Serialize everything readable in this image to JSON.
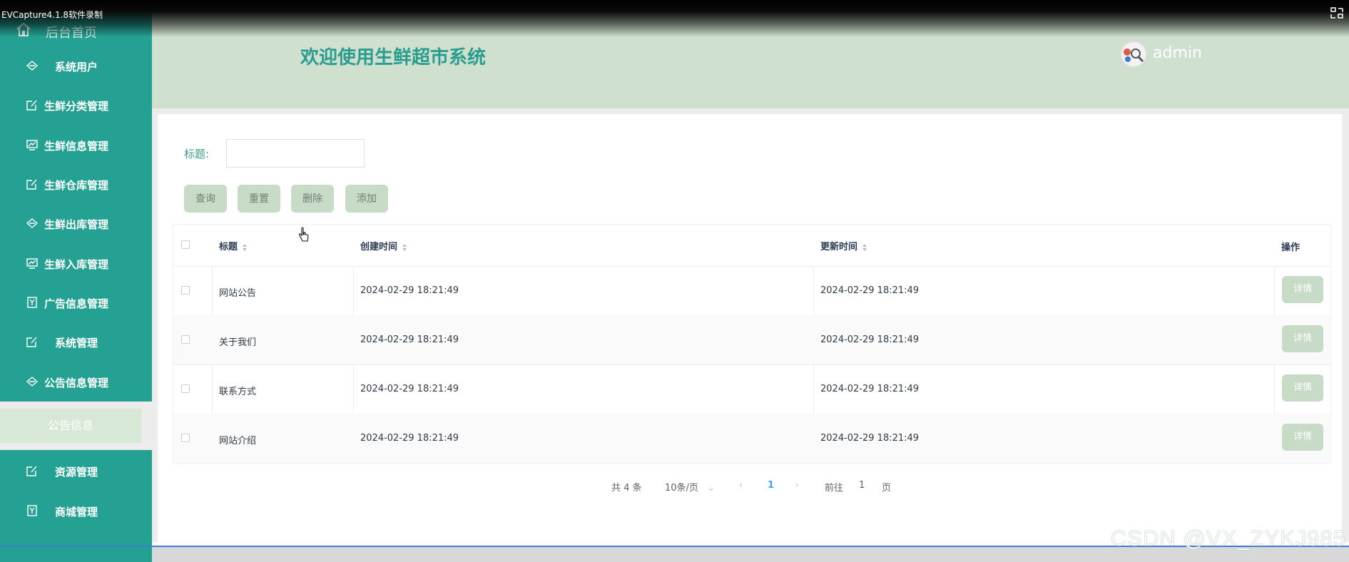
{
  "capture": {
    "title": "EVCapture4.1.8软件录制"
  },
  "header": {
    "site_title": "欢迎使用生鲜超市系统",
    "user_name": "admin"
  },
  "sidebar": {
    "home_label": "后台首页",
    "items": [
      {
        "label": "系统用户",
        "icon": "diamond-icon"
      },
      {
        "label": "生鲜分类管理",
        "icon": "edit-icon"
      },
      {
        "label": "生鲜信息管理",
        "icon": "chart-icon"
      },
      {
        "label": "生鲜仓库管理",
        "icon": "edit-icon"
      },
      {
        "label": "生鲜出库管理",
        "icon": "diamond-icon"
      },
      {
        "label": "生鲜入库管理",
        "icon": "chart-icon"
      },
      {
        "label": "广告信息管理",
        "icon": "badge-icon"
      },
      {
        "label": "系统管理",
        "icon": "edit-icon"
      },
      {
        "label": "公告信息管理",
        "icon": "diamond-icon"
      },
      {
        "label": "资源管理",
        "icon": "edit-icon"
      },
      {
        "label": "商城管理",
        "icon": "badge-icon"
      }
    ],
    "sub_item": {
      "label": "公告信息"
    }
  },
  "search": {
    "label": "标题:",
    "value": ""
  },
  "toolbar": {
    "query": "查询",
    "reset": "重置",
    "delete": "删除",
    "add": "添加"
  },
  "table": {
    "headers": {
      "title": "标题",
      "created": "创建时间",
      "updated": "更新时间",
      "action": "操作"
    },
    "rows": [
      {
        "title": "网站公告",
        "created": "2024-02-29 18:21:49",
        "updated": "2024-02-29 18:21:49",
        "action": "详情"
      },
      {
        "title": "关于我们",
        "created": "2024-02-29 18:21:49",
        "updated": "2024-02-29 18:21:49",
        "action": "详情"
      },
      {
        "title": "联系方式",
        "created": "2024-02-29 18:21:49",
        "updated": "2024-02-29 18:21:49",
        "action": "详情"
      },
      {
        "title": "网站介绍",
        "created": "2024-02-29 18:21:49",
        "updated": "2024-02-29 18:21:49",
        "action": "详情"
      }
    ]
  },
  "pagination": {
    "total": "共 4 条",
    "page_size": "10条/页",
    "current": "1",
    "goto_prefix": "前往",
    "goto_value": "1",
    "goto_suffix": "页"
  },
  "watermark": "CSDN @VX_ZYKJ985",
  "colors": {
    "sidebar": "#24a192",
    "header": "#cfe0cf",
    "button": "#c7dbc6",
    "title": "#2a9d8f",
    "active_page": "#409eff"
  }
}
